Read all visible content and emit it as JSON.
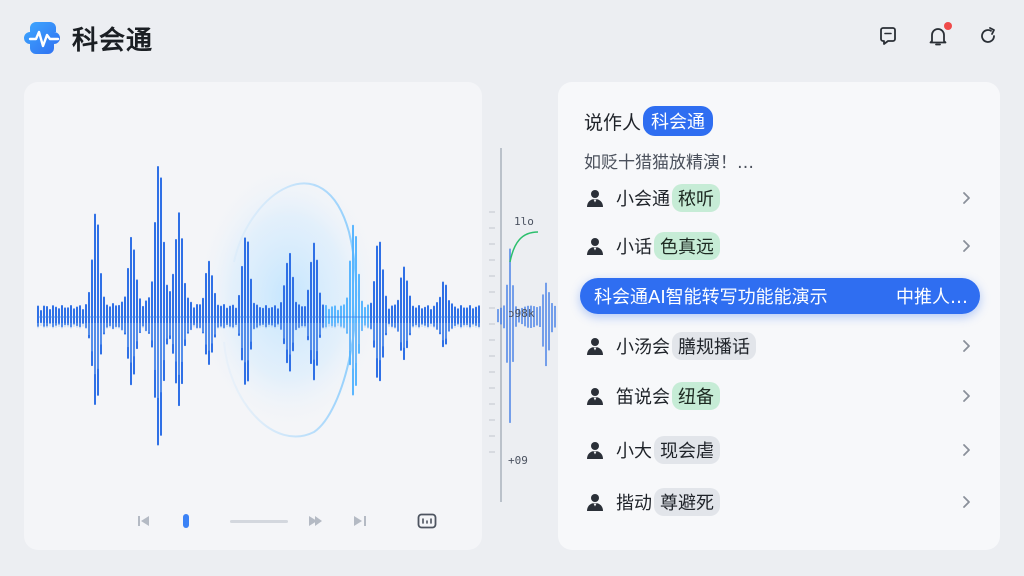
{
  "app": {
    "name": "科会通",
    "brand_color": "#2f6ef1"
  },
  "header": {
    "actions": [
      {
        "icon": "chat-icon"
      },
      {
        "icon": "bell-icon",
        "has_notification": true
      },
      {
        "icon": "refresh-icon"
      }
    ]
  },
  "waveform_panel": {
    "controls": [
      "previous-icon",
      "play-pause-icon",
      "progress-bar",
      "next-icon",
      "skip-end-icon",
      "caption-icon"
    ]
  },
  "scale_strip": {
    "labels": [
      "1lo",
      "ɔ98k",
      "+09"
    ]
  },
  "speaker_list": {
    "title": "说作人",
    "title_chip": "科会通",
    "subtitle": "如贬十猎猫放精演！…",
    "items": [
      {
        "name": "小会通",
        "tag": "秾听",
        "tag_style": "green"
      },
      {
        "name": "小话",
        "tag": "色真远",
        "tag_style": "green"
      },
      {
        "name": "小汤会",
        "tag": "膳规播话",
        "tag_style": "gray"
      },
      {
        "name": "笛说会",
        "tag": "纽备",
        "tag_style": "green"
      },
      {
        "name": "小大",
        "tag": "现会虐",
        "tag_style": "gray"
      },
      {
        "name": "揩动",
        "tag": "尊避死",
        "tag_style": "gray"
      }
    ],
    "active_item": {
      "text": "科会通AI智能转写功能能演示",
      "right_text": "中推人…"
    }
  }
}
